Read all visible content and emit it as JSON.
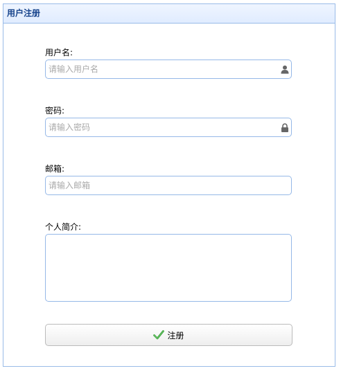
{
  "panel": {
    "title": "用户注册"
  },
  "form": {
    "username": {
      "label": "用户名:",
      "placeholder": "请输入用户名",
      "icon": "user-icon"
    },
    "password": {
      "label": "密码:",
      "placeholder": "请输入密码",
      "icon": "lock-icon"
    },
    "email": {
      "label": "邮箱:",
      "placeholder": "请输入邮箱"
    },
    "bio": {
      "label": "个人简介:"
    },
    "submit": {
      "label": "注册",
      "icon": "check-icon"
    }
  },
  "colors": {
    "border": "#95b8e7",
    "header_text": "#15428b",
    "check_green": "#2e9c2e"
  }
}
